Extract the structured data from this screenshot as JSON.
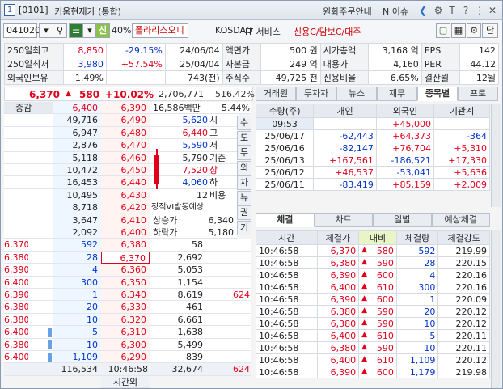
{
  "window": {
    "code": "[0101]",
    "title": "키움현재가 (통합)",
    "links": [
      "원화주문안내",
      "N 이슈"
    ],
    "win_icons": [
      "gear-icon",
      "text-size-icon",
      "help-icon",
      "pin-icon",
      "close-icon"
    ]
  },
  "toolbar": {
    "stock_code": "041020",
    "margin": "신",
    "margin_pct": "40%",
    "stock_name": "폴라리스오피",
    "market": "KOSDAQ",
    "sector": "IT 서비스",
    "flags": "신용C/담보C/대주",
    "right_btn": "단"
  },
  "info": {
    "rows": [
      [
        "250일최고",
        "8,850",
        "-29.15%",
        "24/06/04",
        "액면가",
        "500 원",
        "시가총액",
        "3,168 억",
        "EPS",
        "142"
      ],
      [
        "250일최저",
        "3,980",
        "+57.54%",
        "25/04/04",
        "자본금",
        "249 억",
        "대용가",
        "4,160",
        "PER",
        "44.12"
      ],
      [
        "외국인보유",
        "1.49%",
        "",
        "743(천)",
        "주식수",
        "49,725 천",
        "신용비율",
        "6.65%",
        "결산월",
        "12월"
      ]
    ]
  },
  "price": {
    "current": "6,370",
    "change": "580",
    "rate": "+10.02%",
    "volume": "2,706,771",
    "vol_ratio": "516.42%",
    "amount": "16,586백만",
    "turnover": "5.44%"
  },
  "orderbook": {
    "left_header": "증감",
    "ask": [
      {
        "qty": "49,716",
        "price": "6,490",
        "sub": "5,620",
        "lbl": "시"
      },
      {
        "qty": "6,947",
        "price": "6,480",
        "sub": "6,440",
        "lbl": "고"
      },
      {
        "qty": "2,876",
        "price": "6,470",
        "sub": "5,590",
        "lbl": "저"
      },
      {
        "qty": "5,118",
        "price": "6,460",
        "sub": "5,790",
        "lbl": "기준"
      },
      {
        "qty": "10,472",
        "price": "6,450",
        "sub": "7,520",
        "lbl": "상"
      },
      {
        "qty": "16,453",
        "price": "6,440",
        "sub": "4,060",
        "lbl": "하"
      },
      {
        "qty": "10,495",
        "price": "6,430",
        "sub": "12",
        "lbl": "비용"
      },
      {
        "qty": "8,718",
        "price": "6,420",
        "sub": "정적VI발동예상",
        "lbl": ""
      },
      {
        "qty": "3,647",
        "price": "6,410",
        "sub": "상승가",
        "lbl": "6,340"
      },
      {
        "qty": "2,092",
        "price": "6,400",
        "sub": "하락가",
        "lbl": "5,180"
      }
    ],
    "ask_header_price": "6,390",
    "ask_header_left": "6,400",
    "bid": [
      {
        "lp": "6,370",
        "lq": "592",
        "price": "6,380",
        "qty": "58",
        "x": ""
      },
      {
        "lp": "6,380",
        "lq": "28",
        "price": "6,370",
        "qty": "2,692",
        "x": ""
      },
      {
        "lp": "6,390",
        "lq": "4",
        "price": "6,360",
        "qty": "5,053",
        "x": ""
      },
      {
        "lp": "6,400",
        "lq": "300",
        "price": "6,350",
        "qty": "1,154",
        "x": ""
      },
      {
        "lp": "6,390",
        "lq": "1",
        "price": "6,340",
        "qty": "8,619",
        "x": "624"
      },
      {
        "lp": "6,380",
        "lq": "20",
        "price": "6,330",
        "qty": "461",
        "x": ""
      },
      {
        "lp": "6,380",
        "lq": "10",
        "price": "6,320",
        "qty": "6,661",
        "x": ""
      },
      {
        "lp": "6,400",
        "lq": "5",
        "price": "6,310",
        "qty": "1,638",
        "x": ""
      },
      {
        "lp": "6,380",
        "lq": "10",
        "price": "6,300",
        "qty": "5,499",
        "x": ""
      },
      {
        "lp": "6,400",
        "lq": "1,109",
        "price": "6,290",
        "qty": "839",
        "x": ""
      }
    ],
    "foot": {
      "ask_total": "116,534",
      "time": "10:46:58",
      "bid_total": "32,674",
      "x": "624",
      "after": "시간외"
    }
  },
  "vtabs": [
    "수",
    "도",
    "투",
    "외",
    "차",
    "뉴",
    "권",
    "기"
  ],
  "investor": {
    "tabs": [
      "거래원",
      "투자자",
      "뉴스",
      "재무",
      "종목별",
      "프로"
    ],
    "active": 4,
    "header": [
      "수량(주)",
      "개인",
      "외국인",
      "기관계"
    ],
    "rows": [
      [
        "09:53",
        "",
        "+45,000",
        ""
      ],
      [
        "25/06/17",
        "-62,443",
        "+64,373",
        "-364"
      ],
      [
        "25/06/16",
        "-82,147",
        "+76,704",
        "+5,310"
      ],
      [
        "25/06/13",
        "+167,561",
        "-186,521",
        "+17,330"
      ],
      [
        "25/06/12",
        "+46,537",
        "-53,041",
        "+5,636"
      ],
      [
        "25/06/11",
        "-83,419",
        "+85,159",
        "+2,009"
      ]
    ]
  },
  "trades": {
    "tabs": [
      "체결",
      "차트",
      "일별",
      "예상체결"
    ],
    "header": [
      "시간",
      "체결가",
      "대비",
      "체결량",
      "체결강도"
    ],
    "rows": [
      [
        "10:46:58",
        "6,370",
        "580",
        "592",
        "219.99"
      ],
      [
        "10:46:58",
        "6,380",
        "590",
        "28",
        "220.15"
      ],
      [
        "10:46:58",
        "6,390",
        "600",
        "4",
        "220.16"
      ],
      [
        "10:46:58",
        "6,400",
        "610",
        "300",
        "220.16"
      ],
      [
        "10:46:58",
        "6,390",
        "600",
        "1",
        "220.09"
      ],
      [
        "10:46:58",
        "6,380",
        "590",
        "20",
        "220.12"
      ],
      [
        "10:46:58",
        "6,380",
        "590",
        "10",
        "220.12"
      ],
      [
        "10:46:58",
        "6,400",
        "610",
        "5",
        "220.11"
      ],
      [
        "10:46:58",
        "6,380",
        "590",
        "10",
        "220.11"
      ],
      [
        "10:46:58",
        "6,400",
        "610",
        "1,109",
        "220.12"
      ],
      [
        "10:46:58",
        "6,390",
        "600",
        "1,179",
        "219.98"
      ]
    ]
  }
}
